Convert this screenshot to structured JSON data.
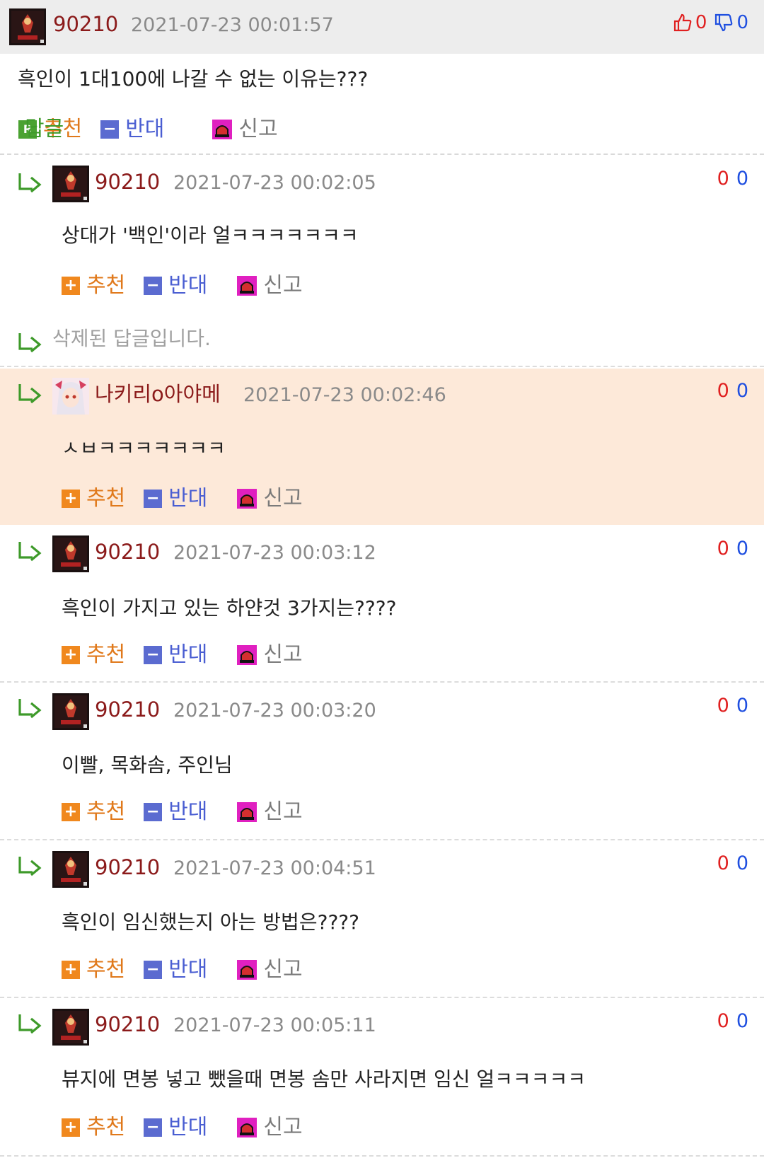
{
  "top_comment": {
    "username": "90210",
    "timestamp": "2021-07-23 00:01:57",
    "upvotes": "0",
    "downvotes": "0",
    "body": "흑인이 1대100에 나갈 수 없는 이유는???",
    "actions": {
      "recommend": "추천",
      "oppose": "반대",
      "reply": "답글",
      "report": "신고"
    }
  },
  "action_labels": {
    "recommend": "추천",
    "oppose": "반대",
    "report": "신고"
  },
  "icons": {
    "reply_badge": "R"
  },
  "deleted_text": "삭제된 답글입니다.",
  "replies": [
    {
      "username": "90210",
      "timestamp": "2021-07-23 00:02:05",
      "up": "0",
      "down": "0",
      "body": "상대가 '백인'이라 얼ㅋㅋㅋㅋㅋㅋㅋ"
    },
    {
      "username": "나키리o아야메",
      "timestamp": "2021-07-23 00:02:46",
      "up": "0",
      "down": "0",
      "body": "ㅅㅂㅋㅋㅋㅋㅋㅋㅋ"
    },
    {
      "username": "90210",
      "timestamp": "2021-07-23 00:03:12",
      "up": "0",
      "down": "0",
      "body": "흑인이 가지고 있는 하얀것 3가지는????"
    },
    {
      "username": "90210",
      "timestamp": "2021-07-23 00:03:20",
      "up": "0",
      "down": "0",
      "body": "이빨, 목화솜, 주인님"
    },
    {
      "username": "90210",
      "timestamp": "2021-07-23 00:04:51",
      "up": "0",
      "down": "0",
      "body": "흑인이 임신했는지 아는 방법은????"
    },
    {
      "username": "90210",
      "timestamp": "2021-07-23 00:05:11",
      "up": "0",
      "down": "0",
      "body": "뷰지에 면봉 넣고 뺐을때 면봉 솜만 사라지면 임신 얼ㅋㅋㅋㅋㅋ"
    }
  ],
  "colors": {
    "username": "#8b1a1a",
    "upvote": "#e02020",
    "downvote": "#1f4fe0",
    "highlight_bg": "#fde9d9",
    "recommend": "#e0791b",
    "oppose": "#4a5ed2",
    "reply": "#3e9a2a"
  }
}
